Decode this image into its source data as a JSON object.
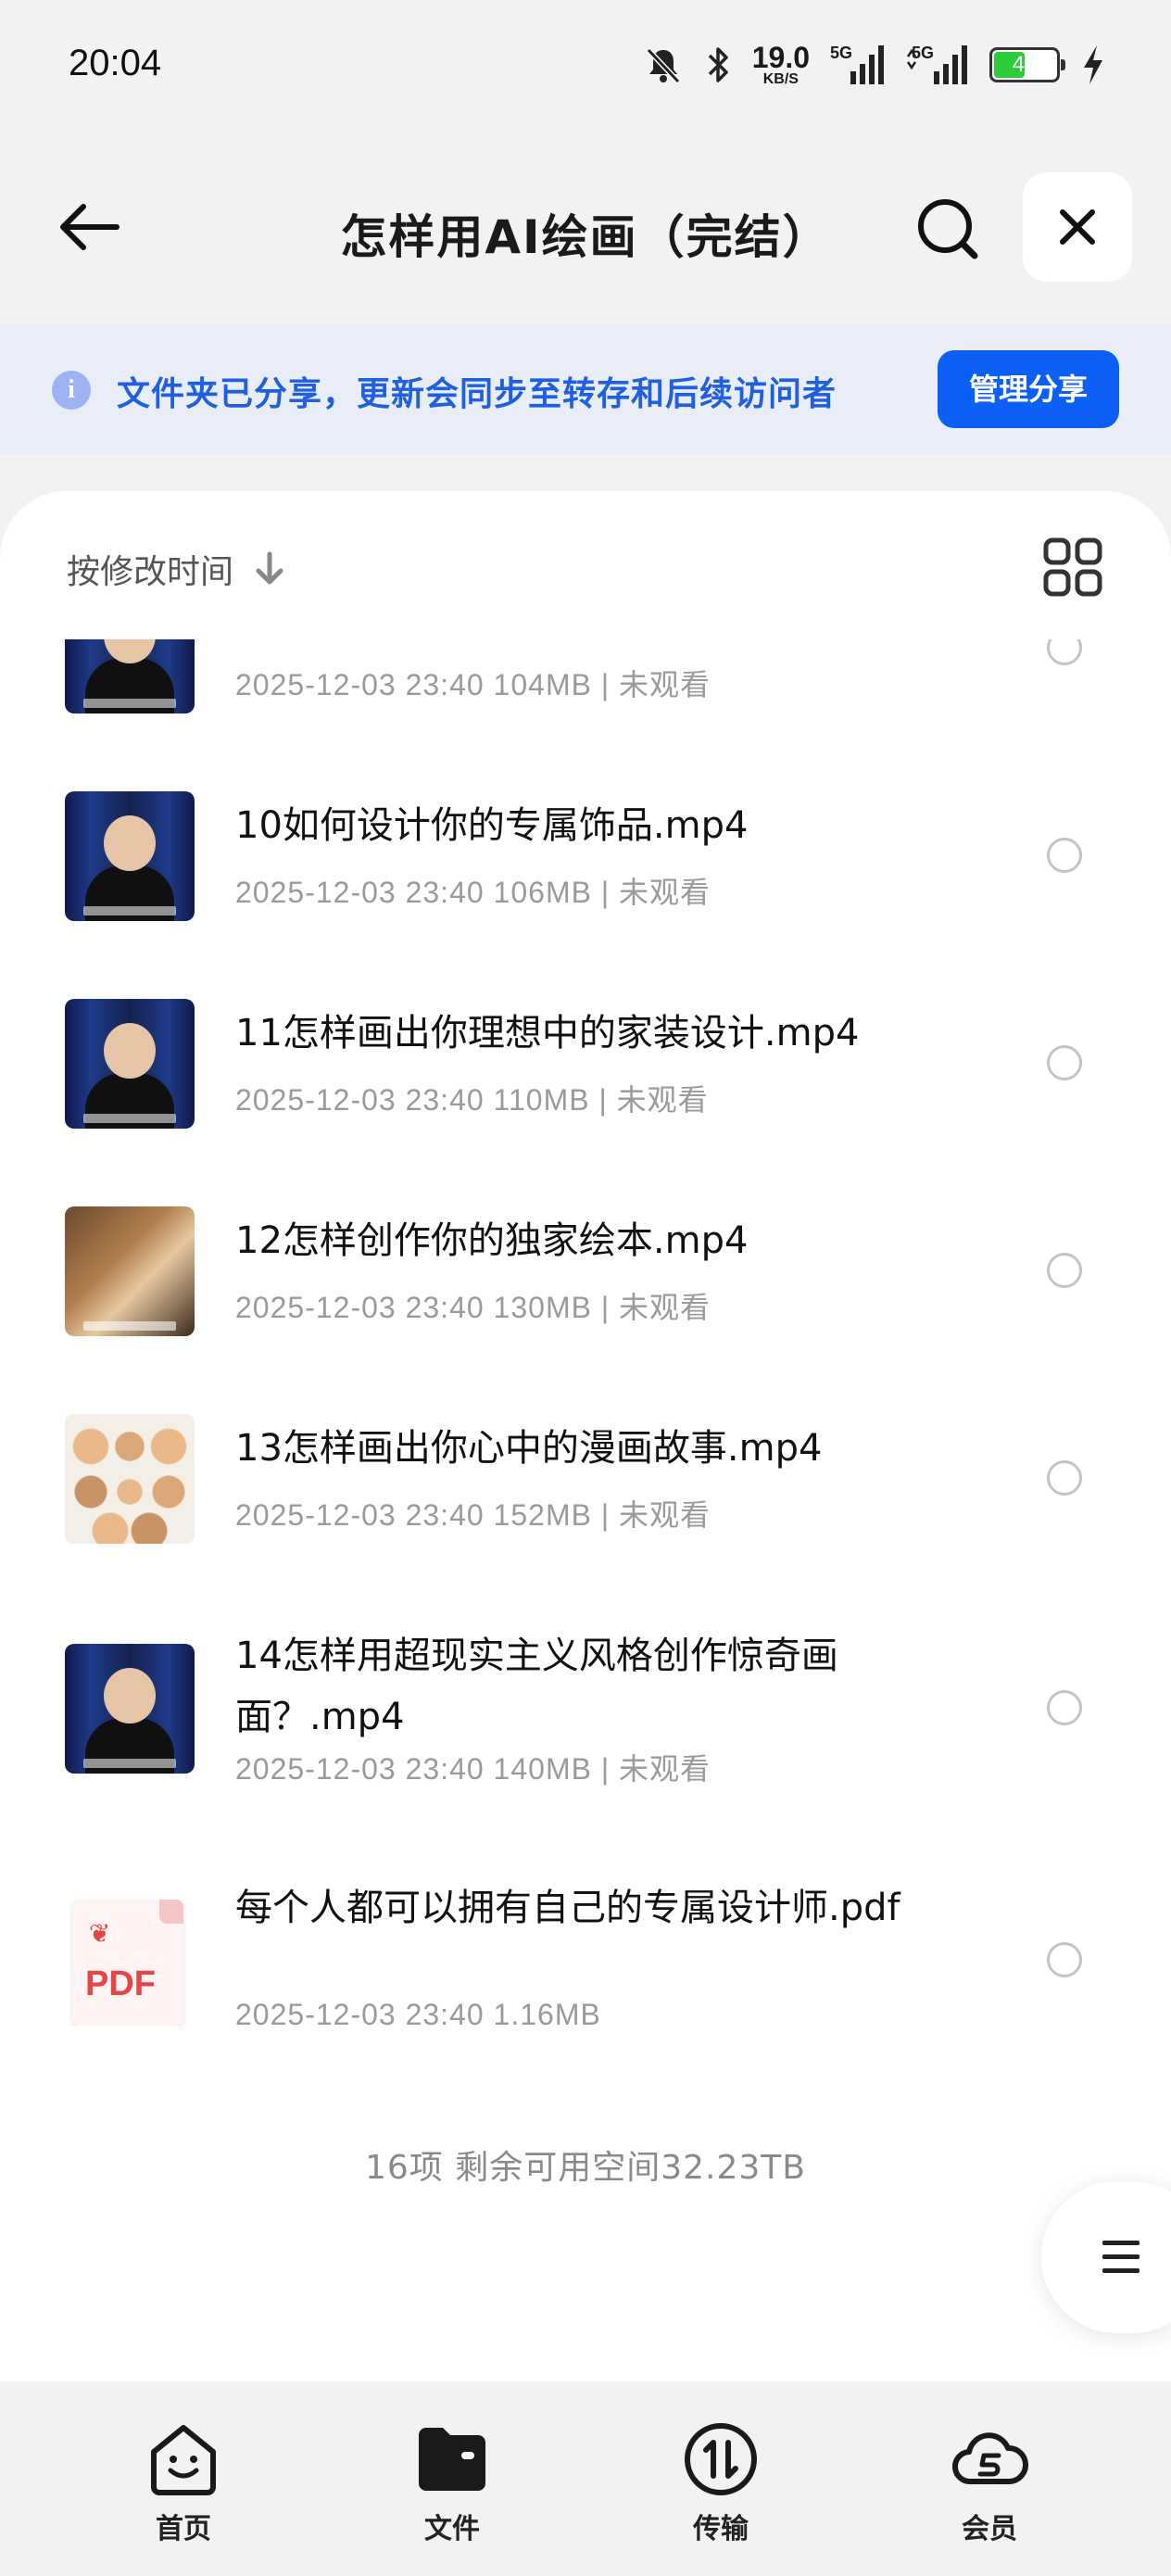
{
  "status_bar": {
    "time": "20:04",
    "net_speed_value": "19.0",
    "net_speed_unit": "KB/S",
    "signal1": "5G",
    "signal2": "5G",
    "battery_level": "47",
    "icons": [
      "mute-icon",
      "bluetooth-icon",
      "signal-icon",
      "battery-icon",
      "charging-icon"
    ]
  },
  "header": {
    "title": "怎样用AI绘画（完结）",
    "icons": [
      "back-arrow-icon",
      "search-icon",
      "close-icon"
    ]
  },
  "share_banner": {
    "text": "文件夹已分享，更新会同步至转存和后续访问者",
    "button_label": "管理分享",
    "icon": "info-icon",
    "color": "#1f5fe0"
  },
  "sort": {
    "label": "按修改时间",
    "icon": "arrow-down-icon"
  },
  "files": [
    {
      "name": "",
      "meta": "2025-12-03 23:40  104MB | 未观看",
      "thumb": "video"
    },
    {
      "name": "10如何设计你的专属饰品.mp4",
      "meta": "2025-12-03 23:40  106MB | 未观看",
      "thumb": "video"
    },
    {
      "name": "11怎样画出你理想中的家装设计.mp4",
      "meta": "2025-12-03 23:40  110MB | 未观看",
      "thumb": "video"
    },
    {
      "name": "12怎样创作你的独家绘本.mp4",
      "meta": "2025-12-03 23:40  130MB | 未观看",
      "thumb": "painting"
    },
    {
      "name": "13怎样画出你心中的漫画故事.mp4",
      "meta": "2025-12-03 23:40  152MB | 未观看",
      "thumb": "comic"
    },
    {
      "name": "14怎样用超现实主义风格创作惊奇画面？.mp4",
      "meta": "2025-12-03 23:40  140MB | 未观看",
      "thumb": "video"
    },
    {
      "name": "每个人都可以拥有自己的专属设计师.pdf",
      "meta": "2025-12-03 23:40  1.16MB",
      "thumb": "pdf",
      "pdf_label": "PDF"
    }
  ],
  "summary": "16项 剩余可用空间32.23TB",
  "bottom_nav": [
    {
      "label": "首页",
      "icon": "home-icon"
    },
    {
      "label": "文件",
      "icon": "folder-icon"
    },
    {
      "label": "传输",
      "icon": "transfer-icon"
    },
    {
      "label": "会员",
      "icon": "vip-cloud-icon"
    }
  ],
  "colors": {
    "accent": "#0b5ff5",
    "banner_bg": "#e8edf8",
    "battery": "#2dcc3a"
  }
}
